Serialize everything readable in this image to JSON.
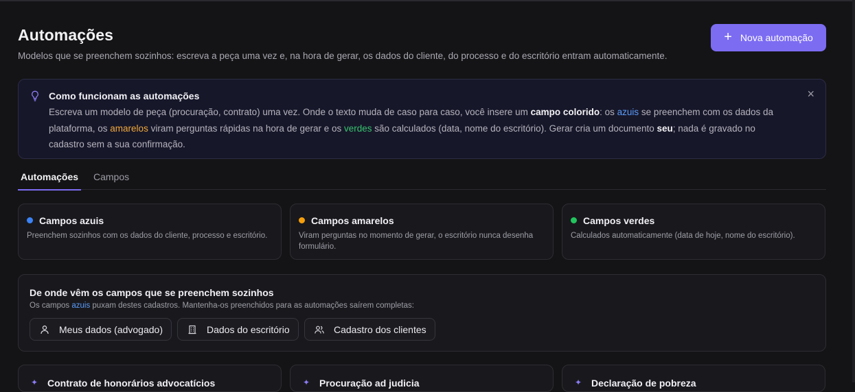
{
  "header": {
    "title": "Automações",
    "subtitle": "Modelos que se preenchem sozinhos: escreva a peça uma vez e, na hora de gerar, os dados do cliente, do processo e do escritório entram automaticamente.",
    "new_button": "Nova automação"
  },
  "info": {
    "title": "Como funcionam as automações",
    "t1": "Escreva um modelo de peça (procuração, contrato) uma vez. Onde o texto muda de caso para caso, você insere um ",
    "t2": "campo colorido",
    "t3": ": os ",
    "t4": "azuis",
    "t5": " se preenchem com os dados da plataforma, os ",
    "t6": "amarelos",
    "t7": " viram perguntas rápidas na hora de gerar e os ",
    "t8": "verdes",
    "t9": " são calculados (data, nome do escritório). Gerar cria um documento ",
    "t10": "seu",
    "t11": "; nada é gravado no cadastro sem a sua confirmação.",
    "close": "×"
  },
  "tabs": [
    {
      "label": "Automações",
      "active": true
    },
    {
      "label": "Campos",
      "active": false
    }
  ],
  "field_cards": [
    {
      "title": "Campos azuis",
      "desc": "Preenchem sozinhos com os dados do cliente, processo e escritório.",
      "color": "#3b82f6"
    },
    {
      "title": "Campos amarelos",
      "desc": "Viram perguntas no momento de gerar, o escritório nunca desenha formulário.",
      "color": "#f59e0b"
    },
    {
      "title": "Campos verdes",
      "desc": "Calculados automaticamente (data de hoje, nome do escritório).",
      "color": "#22c55e"
    }
  ],
  "sources": {
    "title": "De onde vêm os campos que se preenchem sozinhos",
    "sub1": "Os campos ",
    "sub2": "azuis",
    "sub3": " puxam destes cadastros. Mantenha-os preenchidos para as automações saírem completas:",
    "chips": [
      {
        "label": "Meus dados (advogado)",
        "icon": "user-icon"
      },
      {
        "label": "Dados do escritório",
        "icon": "building-icon"
      },
      {
        "label": "Cadastro dos clientes",
        "icon": "users-icon"
      }
    ]
  },
  "bottom_cards": [
    {
      "title": "Contrato de honorários advocatícios"
    },
    {
      "title": "Procuração ad judicia"
    },
    {
      "title": "Declaração de pobreza"
    }
  ],
  "colors": {
    "accent": "#7c6cf2",
    "blue": "#5b9cf8",
    "yellow": "#f0a93b",
    "green": "#37c46e"
  }
}
